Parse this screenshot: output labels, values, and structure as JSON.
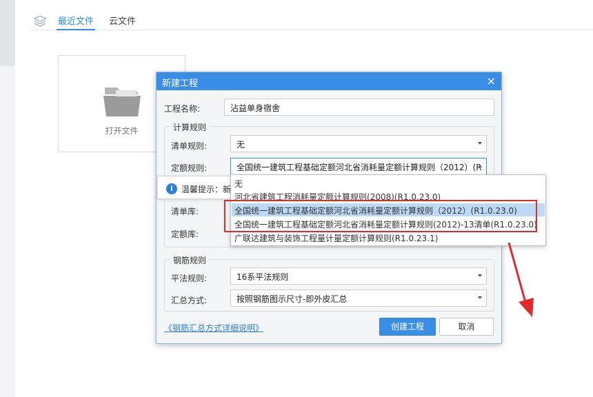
{
  "tabs": {
    "recent": "最近文件",
    "cloud": "云文件"
  },
  "open_card": {
    "label": "打开文件"
  },
  "dialog": {
    "title": "新建工程",
    "close": "×",
    "project_name_label": "工程名称:",
    "project_name_value": "沾益单身宿舍",
    "calc_rules": {
      "title": "计算规则",
      "bill_rule_label": "清单规则:",
      "bill_rule_value": "无",
      "quota_rule_label": "定额规则:",
      "quota_rule_value": "全国统一建筑工程基础定额河北省消耗量定额计算规则（2012）(R",
      "bill_lib_label": "清单库:",
      "quota_lib_label": "定额库:"
    },
    "rebar_rules": {
      "title": "钢筋规则",
      "flat_rule_label": "平法规则:",
      "flat_rule_value": "16系平法规则",
      "summary_label": "汇总方式:",
      "summary_value": "按照钢筋图示尺寸-即外皮汇总"
    },
    "help_link": "《钢筋汇总方式详细说明》",
    "create_button": "创建工程",
    "cancel_button": "取消"
  },
  "tip": {
    "icon": "i",
    "text": "温馨提示：新"
  },
  "dropdown": {
    "options": [
      "无",
      "河北省建筑工程消耗量定额计算规则(2008)(R1.0.23.0)",
      "全国统一建筑工程基础定额河北省消耗量定额计算规则（2012）(R1.0.23.0)",
      "全国统一建筑工程基础定额河北省消耗量定额计算规则(2012)-13清单(R1.0.23.0)",
      "广联达建筑与装饰工程量计量定额计算规则(R1.0.23.1)"
    ],
    "selected_index": 2
  },
  "colors": {
    "accent": "#3a8ee6",
    "highlight": "#e02a2a"
  }
}
